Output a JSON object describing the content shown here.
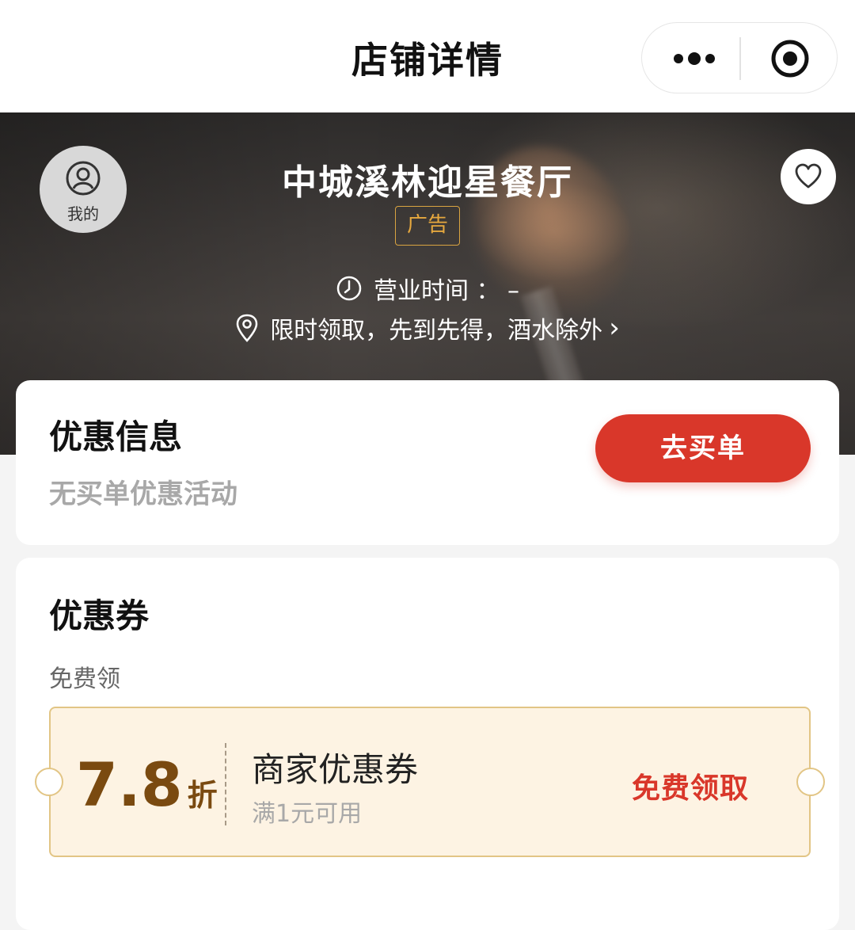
{
  "navbar": {
    "title": "店铺详情",
    "more_icon": "more-dots-icon",
    "close_icon": "target-icon"
  },
  "hero": {
    "me_label": "我的",
    "store_name": "中城溪林迎星餐厅",
    "ad_tag": "广告",
    "hours_label": "营业时间 ： –",
    "promo_text": "限时领取，先到先得，酒水除外",
    "promo_chevron": "›"
  },
  "offer": {
    "title": "优惠信息",
    "subtitle": "无买单优惠活动",
    "pay_button": "去买单"
  },
  "coupons": {
    "title": "优惠券",
    "free_label": "免费领",
    "items": [
      {
        "discount": "7.8",
        "unit": "折",
        "name": "商家优惠券",
        "condition": "满1元可用",
        "action": "免费领取"
      }
    ]
  },
  "colors": {
    "accent_red": "#d9372a",
    "ad_gold": "#e6a83e",
    "coupon_bg": "#fdf3e3",
    "coupon_border": "#e2c585",
    "discount_brown": "#7a4a10"
  }
}
